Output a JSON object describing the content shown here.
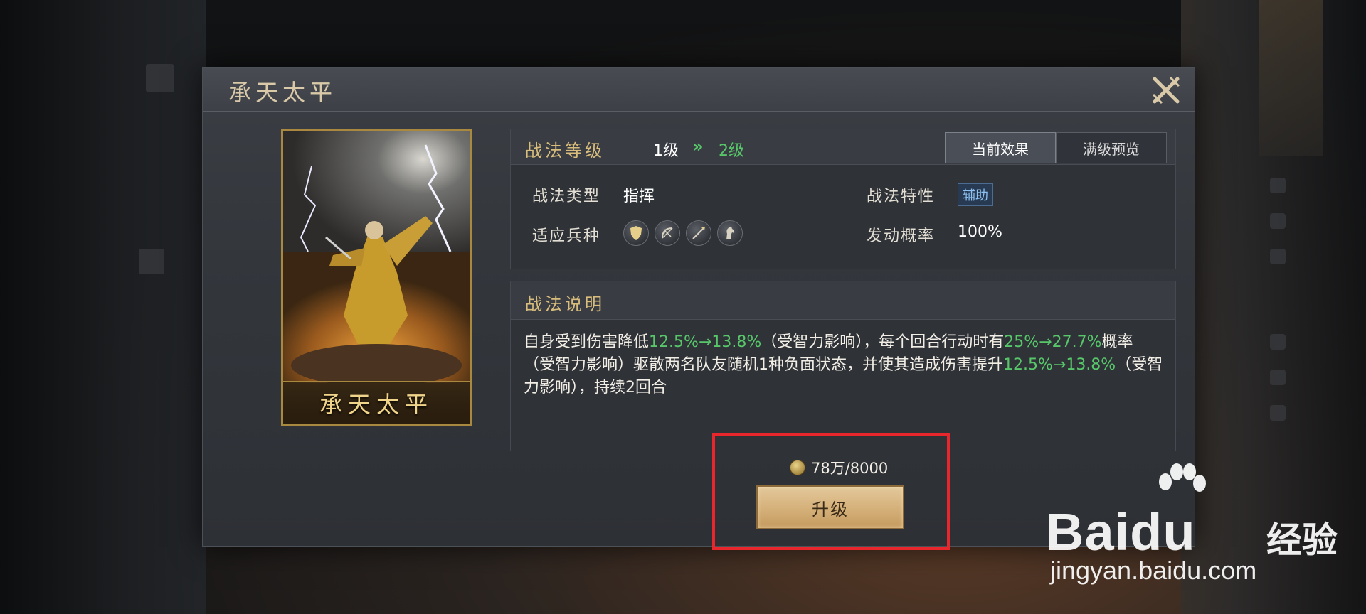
{
  "dialog": {
    "title": "承天太平"
  },
  "card": {
    "name": "承天太平"
  },
  "level": {
    "section_title": "战法等级",
    "current": "1级",
    "arrow": "»",
    "next": "2级"
  },
  "tabs": [
    {
      "label": "当前效果",
      "active": true
    },
    {
      "label": "满级预览",
      "active": false
    }
  ],
  "fields": {
    "type_label": "战法类型",
    "type_value": "指挥",
    "trait_label": "战法特性",
    "trait_value": "辅助",
    "units_label": "适应兵种",
    "units": [
      "shield-icon",
      "bow-icon",
      "spear-icon",
      "horse-icon"
    ],
    "chance_label": "发动概率",
    "chance_value": "100%"
  },
  "description": {
    "title": "战法说明",
    "segments": [
      {
        "text": "自身受到伤害降低",
        "hl": false
      },
      {
        "text": "12.5%→13.8%",
        "hl": true
      },
      {
        "text": "（受智力影响），每个回合行动时有",
        "hl": false
      },
      {
        "text": "25%→27.7%",
        "hl": true
      },
      {
        "text": "概率（受智力影响）驱散两名队友随机1种负面状态，并使其造成伤害提升",
        "hl": false
      },
      {
        "text": "12.5%→13.8%",
        "hl": true
      },
      {
        "text": "（受智力影响），持续2回合",
        "hl": false
      }
    ]
  },
  "cost": {
    "value": "78万/8000"
  },
  "upgrade": {
    "label": "升级"
  },
  "watermark": {
    "brand": "Baidu",
    "product": "经验",
    "url": "jingyan.baidu.com"
  },
  "colors": {
    "highlight_green": "#57c76a",
    "title_gold": "#d9bd7c",
    "annotation_red": "#e8262c"
  }
}
